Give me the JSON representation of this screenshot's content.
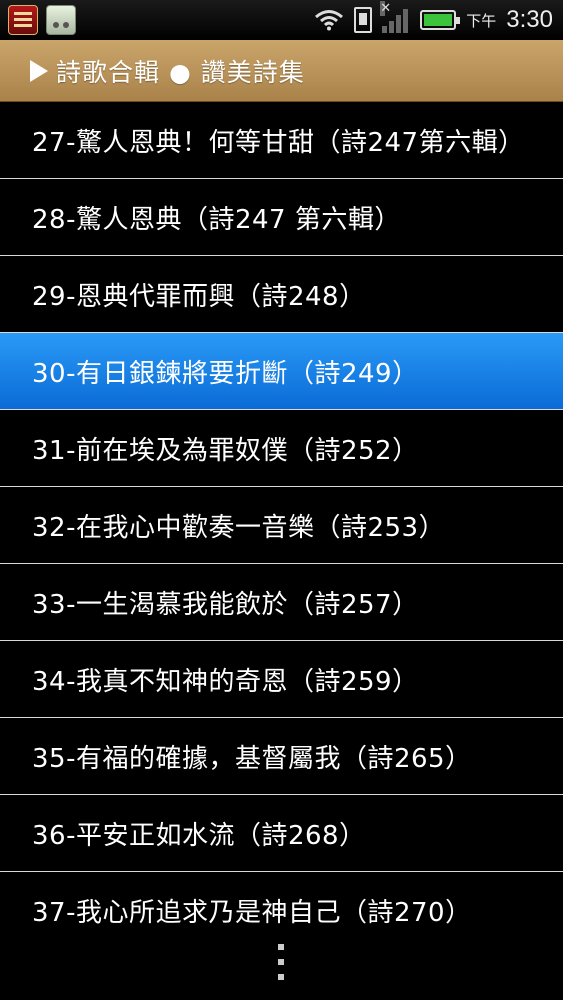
{
  "status_bar": {
    "ampm": "下午",
    "time": "3:30",
    "notification_icons": [
      "app-icon",
      "cassette-icon"
    ],
    "right_icons": [
      "wifi-icon",
      "sim-icon",
      "signal-icon",
      "battery-icon"
    ]
  },
  "title_bar": {
    "title": "詩歌合輯 ● 讚美詩集"
  },
  "list": {
    "items": [
      {
        "label": "27-驚人恩典！何等甘甜（詩247第六輯）"
      },
      {
        "label": "28-驚人恩典（詩247 第六輯）"
      },
      {
        "label": "29-恩典代罪而興（詩248）"
      },
      {
        "label": "30-有日銀鍊將要折斷（詩249）"
      },
      {
        "label": "31-前在埃及為罪奴僕（詩252）"
      },
      {
        "label": "32-在我心中歡奏一音樂（詩253）"
      },
      {
        "label": "33-一生渴慕我能飲於（詩257）"
      },
      {
        "label": "34-我真不知神的奇恩（詩259）"
      },
      {
        "label": "35-有福的確據，基督屬我（詩265）"
      },
      {
        "label": "36-平安正如水流（詩268）"
      },
      {
        "label": "37-我心所追求乃是神自己（詩270）"
      }
    ],
    "selected_index": 3
  },
  "colors": {
    "title_bar": "#b8915a",
    "selected": "#1a84ea",
    "background": "#000000"
  }
}
